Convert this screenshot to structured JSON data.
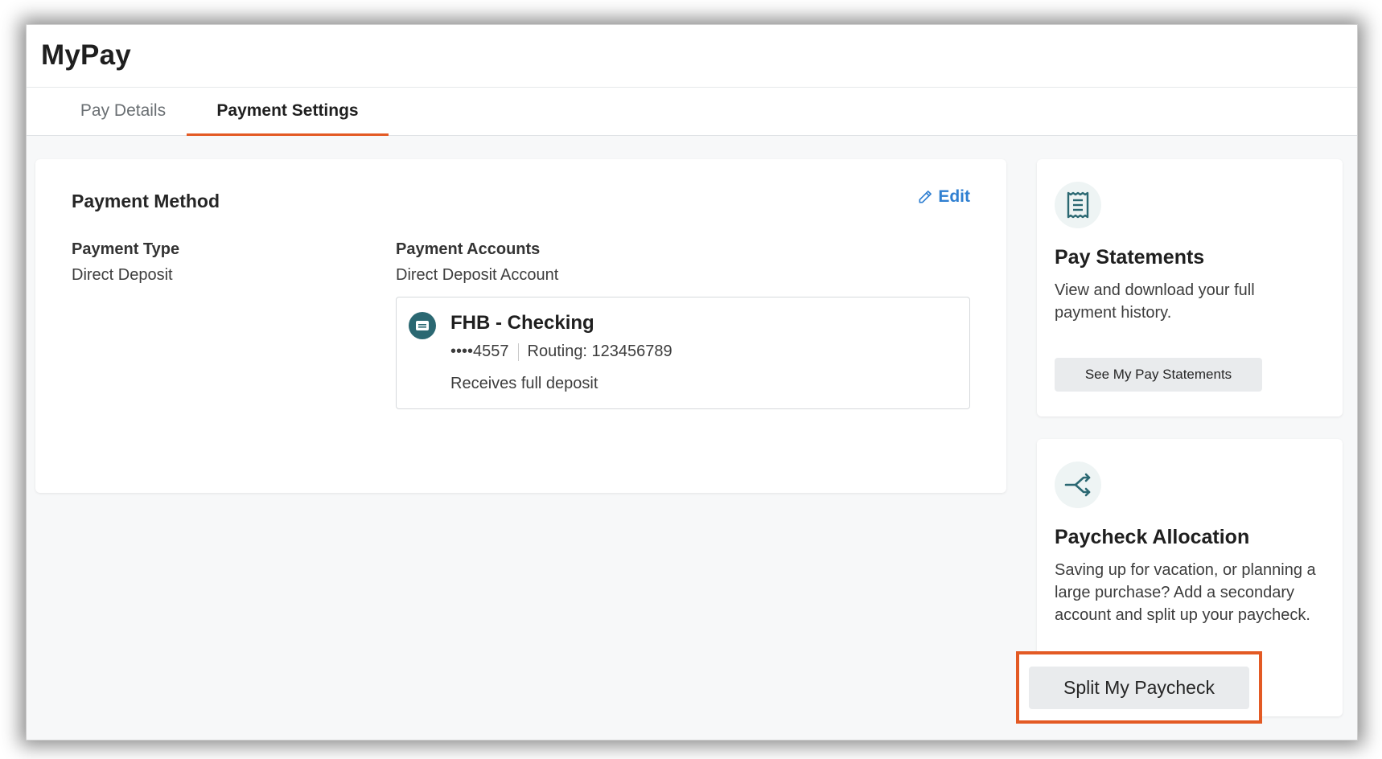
{
  "app": {
    "title": "MyPay"
  },
  "tabs": [
    {
      "label": "Pay Details",
      "active": false
    },
    {
      "label": "Payment Settings",
      "active": true
    }
  ],
  "payment_method": {
    "title": "Payment Method",
    "edit_label": "Edit",
    "type_label": "Payment Type",
    "type_value": "Direct Deposit",
    "accounts_label": "Payment Accounts",
    "accounts_value": "Direct Deposit Account",
    "account": {
      "name": "FHB - Checking",
      "masked_number": "••••4557",
      "routing": "Routing: 123456789",
      "note": "Receives full deposit",
      "icon": "bank-card-icon"
    }
  },
  "pay_statements": {
    "icon": "receipt-icon",
    "title": "Pay Statements",
    "description": "View and download your full payment history.",
    "button_label": "See My Pay Statements"
  },
  "paycheck_allocation": {
    "icon": "split-arrows-icon",
    "title": "Paycheck Allocation",
    "description": "Saving up for vacation, or planning a large purchase? Add a secondary account and split up your paycheck.",
    "button_label": "Split My Paycheck"
  },
  "colors": {
    "accent": "#e35a24",
    "link": "#2f7fd1",
    "icon_teal": "#2b6872"
  }
}
